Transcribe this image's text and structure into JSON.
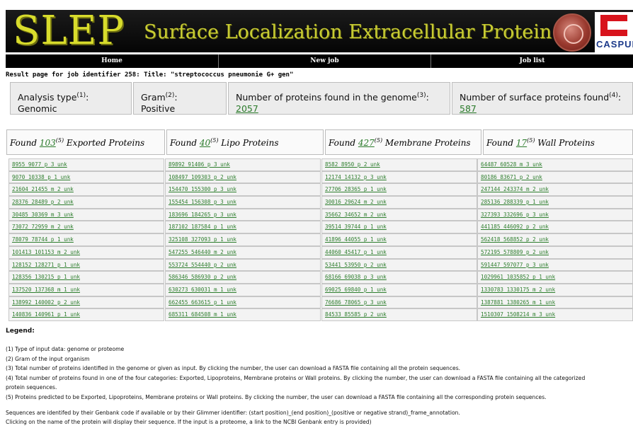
{
  "header": {
    "logo": "SLEP",
    "subtitle": "Surface Localization Extracellular Protein",
    "partner": "CASPUR"
  },
  "nav": [
    "Home",
    "New job",
    "Job list"
  ],
  "result_title": "Result page for job identifier 258: Title: \"streptococcus pneumonie G+ gen\"",
  "summary": {
    "analysis_label": "Analysis type",
    "analysis_sup": "(1)",
    "analysis_colon": ":",
    "analysis_value": "Genomic",
    "gram_label": "Gram",
    "gram_sup": "(2)",
    "gram_colon": ":",
    "gram_value": "Positive",
    "genome_label": "Number of proteins found in the genome",
    "genome_sup": "(3)",
    "genome_colon": ":",
    "genome_value": "2057",
    "surface_label": "Number of surface proteins found",
    "surface_sup": "(4)",
    "surface_colon": ":",
    "surface_value": "587"
  },
  "found_prefix": "Found ",
  "found_sup": "(5)",
  "categories": [
    {
      "count": "103",
      "label": " Exported Proteins"
    },
    {
      "count": "40",
      "label": " Lipo Proteins"
    },
    {
      "count": "427",
      "label": " Membrane Proteins"
    },
    {
      "count": "17",
      "label": " Wall Proteins"
    }
  ],
  "columns": [
    [
      "8955_9077_p_3_unk",
      "9070_10338_p_1_unk",
      "21604_21455_m_2_unk",
      "28376_28489_p_2_unk",
      "30485_30369_m_3_unk",
      "73072_72959_m_2_unk",
      "78079_78744_p_1_unk",
      "101413_101153_m_2_unk",
      "128152_128271_p_1_unk",
      "128356_130215_p_1_unk",
      "137520_137368_m_1_unk",
      "138992_140002_p_2_unk",
      "140836_140961_p_1_unk"
    ],
    [
      "89892_91406_p_3_unk",
      "108497_109303_p_2_unk",
      "154470_155300_p_3_unk",
      "155454_156308_p_3_unk",
      "183696_184265_p_3_unk",
      "187102_187584_p_1_unk",
      "325108_327093_p_1_unk",
      "547255_546440_m_2_unk",
      "553724_554440_p_2_unk",
      "586346_586930_p_2_unk",
      "630273_630031_m_1_unk",
      "662455_663615_p_1_unk",
      "685311_684508_m_1_unk"
    ],
    [
      "8582_8950_p_2_unk",
      "12174_14132_p_3_unk",
      "27706_28365_p_1_unk",
      "30016_29624_m_2_unk",
      "35662_34652_m_2_unk",
      "39514_39744_p_1_unk",
      "41896_44055_p_1_unk",
      "44060_45417_p_1_unk",
      "53441_53950_p_2_unk",
      "68166_69038_p_3_unk",
      "69025_69840_p_1_unk",
      "76686_78065_p_3_unk",
      "84533_85585_p_2_unk"
    ],
    [
      "64487_60528_m_3_unk",
      "80186_83671_p_2_unk",
      "247144_243374_m_2_unk",
      "285136_288339_p_1_unk",
      "327393_332696_p_3_unk",
      "441185_446092_p_2_unk",
      "562418_568852_p_2_unk",
      "572195_578809_p_2_unk",
      "591447_597077_p_3_unk",
      "1029961_1035852_p_1_unk",
      "1330783_1330175_m_2_unk",
      "1387881_1380265_m_1_unk",
      "1510307_1508214_m_3_unk"
    ]
  ],
  "legend": {
    "heading": "Legend:",
    "lines": [
      "(1) Type of input data: genome or proteome",
      "(2) Gram of the input organism",
      "(3) Total number of proteins identified in the genome or given as input. By clicking the number, the user can download a FASTA file containing all the protein sequences.",
      "(4) Total number of proteins found in one of the four categories: Exported, Lipoproteins, Membrane proteins or Wall proteins. By clicking the number, the user can download a FASTA file containing all the categorized",
      "protein sequences.",
      "(5) Proteins predicted to be Exported, Lipoproteins, Membrane proteins or Wall proteins. By clicking the number, the user can download a FASTA file containing all the corresponding protein sequences."
    ],
    "notes": [
      "Sequences are identifed by their Genbank code if available or by their Glimmer identifier: (start position)_(end position)_(positive or negative strand)_frame_annotation.",
      "Clicking on the name of the protein will display their sequence. If the input is a proteome, a link to the NCBI Genbank entry is provided)"
    ]
  }
}
